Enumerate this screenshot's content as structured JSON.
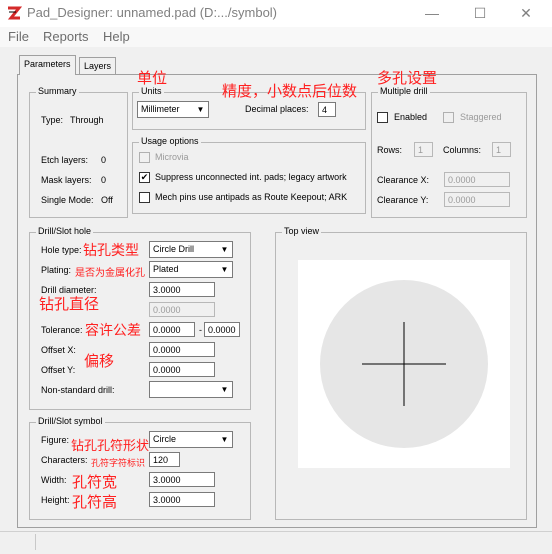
{
  "window": {
    "title": "Pad_Designer: unnamed.pad (D:.../symbol)",
    "minimize": "—",
    "maximize": "☐",
    "close": "✕"
  },
  "menu": [
    "File",
    "Reports",
    "Help"
  ],
  "tabs": [
    "Parameters",
    "Layers"
  ],
  "summary": {
    "title": "Summary",
    "type_label": "Type:",
    "type_value": "Through",
    "etch_label": "Etch layers:",
    "etch_value": "0",
    "mask_label": "Mask layers:",
    "mask_value": "0",
    "single_label": "Single Mode:",
    "single_value": "Off"
  },
  "units": {
    "title": "Units",
    "value": "Millimeter",
    "decimal_label": "Decimal places:",
    "decimal_value": "4"
  },
  "usage": {
    "title": "Usage options",
    "microvia": "Microvia",
    "suppress": "Suppress unconnected int. pads; legacy artwork",
    "mech": "Mech pins use antipads as Route Keepout; ARK"
  },
  "multiple_drill": {
    "title": "Multiple drill",
    "enabled": "Enabled",
    "staggered": "Staggered",
    "rows_label": "Rows:",
    "rows_value": "1",
    "columns_label": "Columns:",
    "columns_value": "1",
    "clearance_x_label": "Clearance X:",
    "clearance_x_value": "0.0000",
    "clearance_y_label": "Clearance Y:",
    "clearance_y_value": "0.0000"
  },
  "drill_hole": {
    "title": "Drill/Slot hole",
    "hole_type_label": "Hole type:",
    "hole_type_value": "Circle Drill",
    "plating_label": "Plating:",
    "plating_value": "Plated",
    "diameter_label": "Drill diameter:",
    "diameter_value": "3.0000",
    "diameter_value2": "0.0000",
    "tolerance_label": "Tolerance:",
    "tolerance_plus": "0.0000",
    "tolerance_dash": "-",
    "tolerance_minus": "0.0000",
    "offset_x_label": "Offset X:",
    "offset_x_value": "0.0000",
    "offset_y_label": "Offset Y:",
    "offset_y_value": "0.0000",
    "nonstd_label": "Non-standard drill:",
    "nonstd_value": ""
  },
  "drill_symbol": {
    "title": "Drill/Slot symbol",
    "figure_label": "Figure:",
    "figure_value": "Circle",
    "characters_label": "Characters:",
    "characters_value": "120",
    "width_label": "Width:",
    "width_value": "3.0000",
    "height_label": "Height:",
    "height_value": "3.0000"
  },
  "top_view": {
    "title": "Top view"
  },
  "annotations": {
    "units": "单位",
    "precision": "精度，小数点后位数",
    "multi": "多孔设置",
    "hole_type": "钻孔类型",
    "plating": "是否为金属化孔",
    "diameter": "钻孔直径",
    "tolerance": "容许公差",
    "offset": "偏移",
    "figure": "钻孔孔符形状",
    "characters": "孔符字符标识",
    "width": "孔符宽",
    "height": "孔符高"
  },
  "colors": {
    "annotation": "#ff2020",
    "icon_red": "#d42a2a"
  }
}
